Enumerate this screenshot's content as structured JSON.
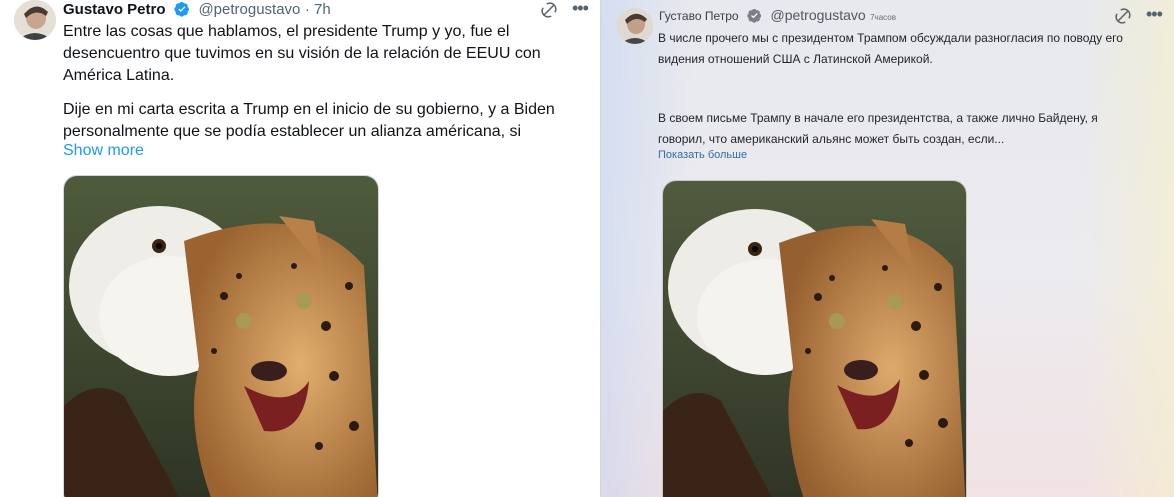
{
  "left_tweet": {
    "author_name": "Gustavo Petro",
    "handle": "@petrogustavo",
    "time": "· 7h",
    "paragraph1": "Entre las cosas que hablamos, el presidente Trump y yo, fue el desencuentro que tuvimos en su visión de la relación de EEUU con América Latina.",
    "paragraph2": "Dije en mi carta escrita a Trump en el inicio de su gobierno, y a Biden personalmente que se podía establecer un alianza américana, si",
    "show_more": "Show more"
  },
  "right_tweet": {
    "author_name": "Густаво Петро",
    "handle": "@petrogustavo",
    "time": "7часов",
    "paragraph1": "В числе прочего мы с президентом Трампом обсуждали разногласия по поводу его видения отношений США с Латинской Америкой.",
    "paragraph2": "В своем письме Трампу в начале его президентства, а также лично Байдену, я говорил, что американский альянс может быть создан, если...",
    "show_more": "Показать больше"
  },
  "colors": {
    "link_blue": "#1d9bf0",
    "verified_blue": "#1d9bf0",
    "text_primary": "#0f1419",
    "text_secondary": "#536471"
  },
  "icons": [
    "verified-badge-icon",
    "grok-icon",
    "more-icon"
  ]
}
